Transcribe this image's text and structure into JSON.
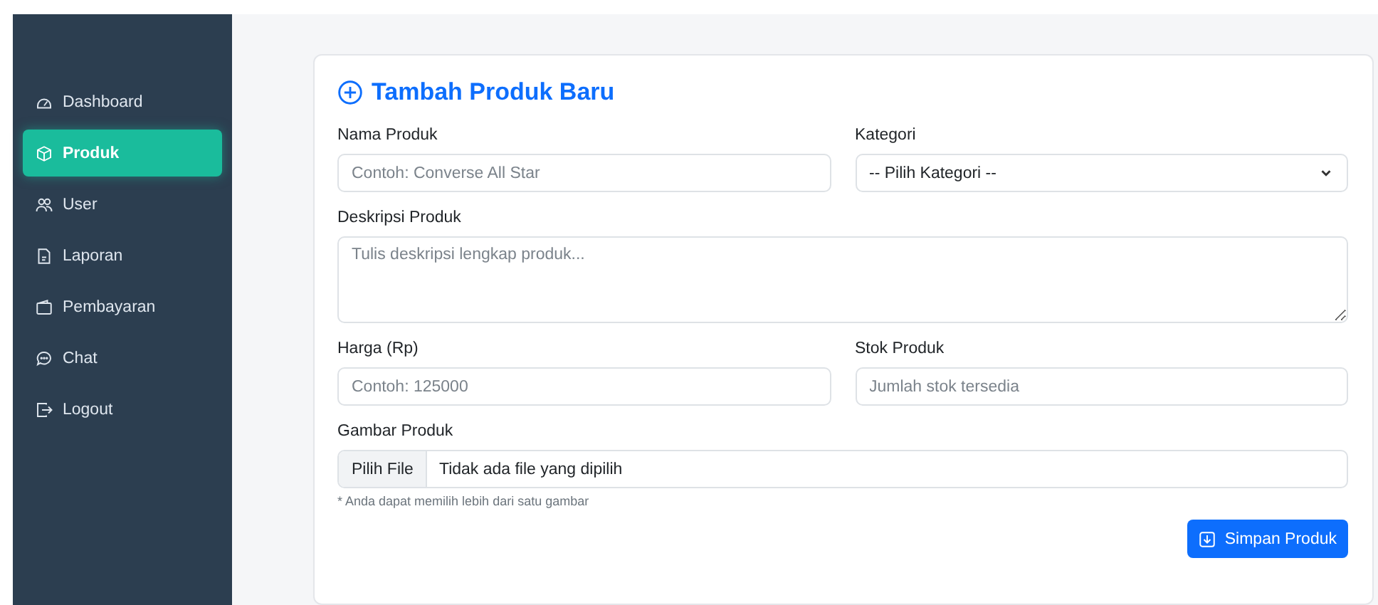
{
  "sidebar": {
    "items": [
      {
        "label": "Dashboard",
        "selected": false
      },
      {
        "label": "Produk",
        "selected": true
      },
      {
        "label": "User",
        "selected": false
      },
      {
        "label": "Laporan",
        "selected": false
      },
      {
        "label": "Pembayaran",
        "selected": false
      },
      {
        "label": "Chat",
        "selected": false
      },
      {
        "label": "Logout",
        "selected": false
      }
    ]
  },
  "form": {
    "title": "Tambah Produk Baru",
    "rows": [
      [
        {
          "kind": "text",
          "label": "Nama Produk",
          "placeholder": "Contoh: Converse All Star"
        },
        {
          "kind": "select",
          "label": "Kategori",
          "value": "-- Pilih Kategori --"
        }
      ],
      [
        {
          "kind": "textarea",
          "label": "Deskripsi Produk",
          "placeholder": "Tulis deskripsi lengkap produk..."
        }
      ],
      [
        {
          "kind": "text",
          "label": "Harga (Rp)",
          "placeholder": "Contoh: 125000"
        },
        {
          "kind": "text",
          "label": "Stok Produk",
          "placeholder": "Jumlah stok tersedia"
        }
      ],
      [
        {
          "kind": "file",
          "label": "Gambar Produk",
          "button": "Pilih File",
          "value": "Tidak ada file yang dipilih",
          "help": "* Anda dapat memilih lebih dari satu gambar"
        }
      ]
    ],
    "submit": "Simpan Produk"
  }
}
